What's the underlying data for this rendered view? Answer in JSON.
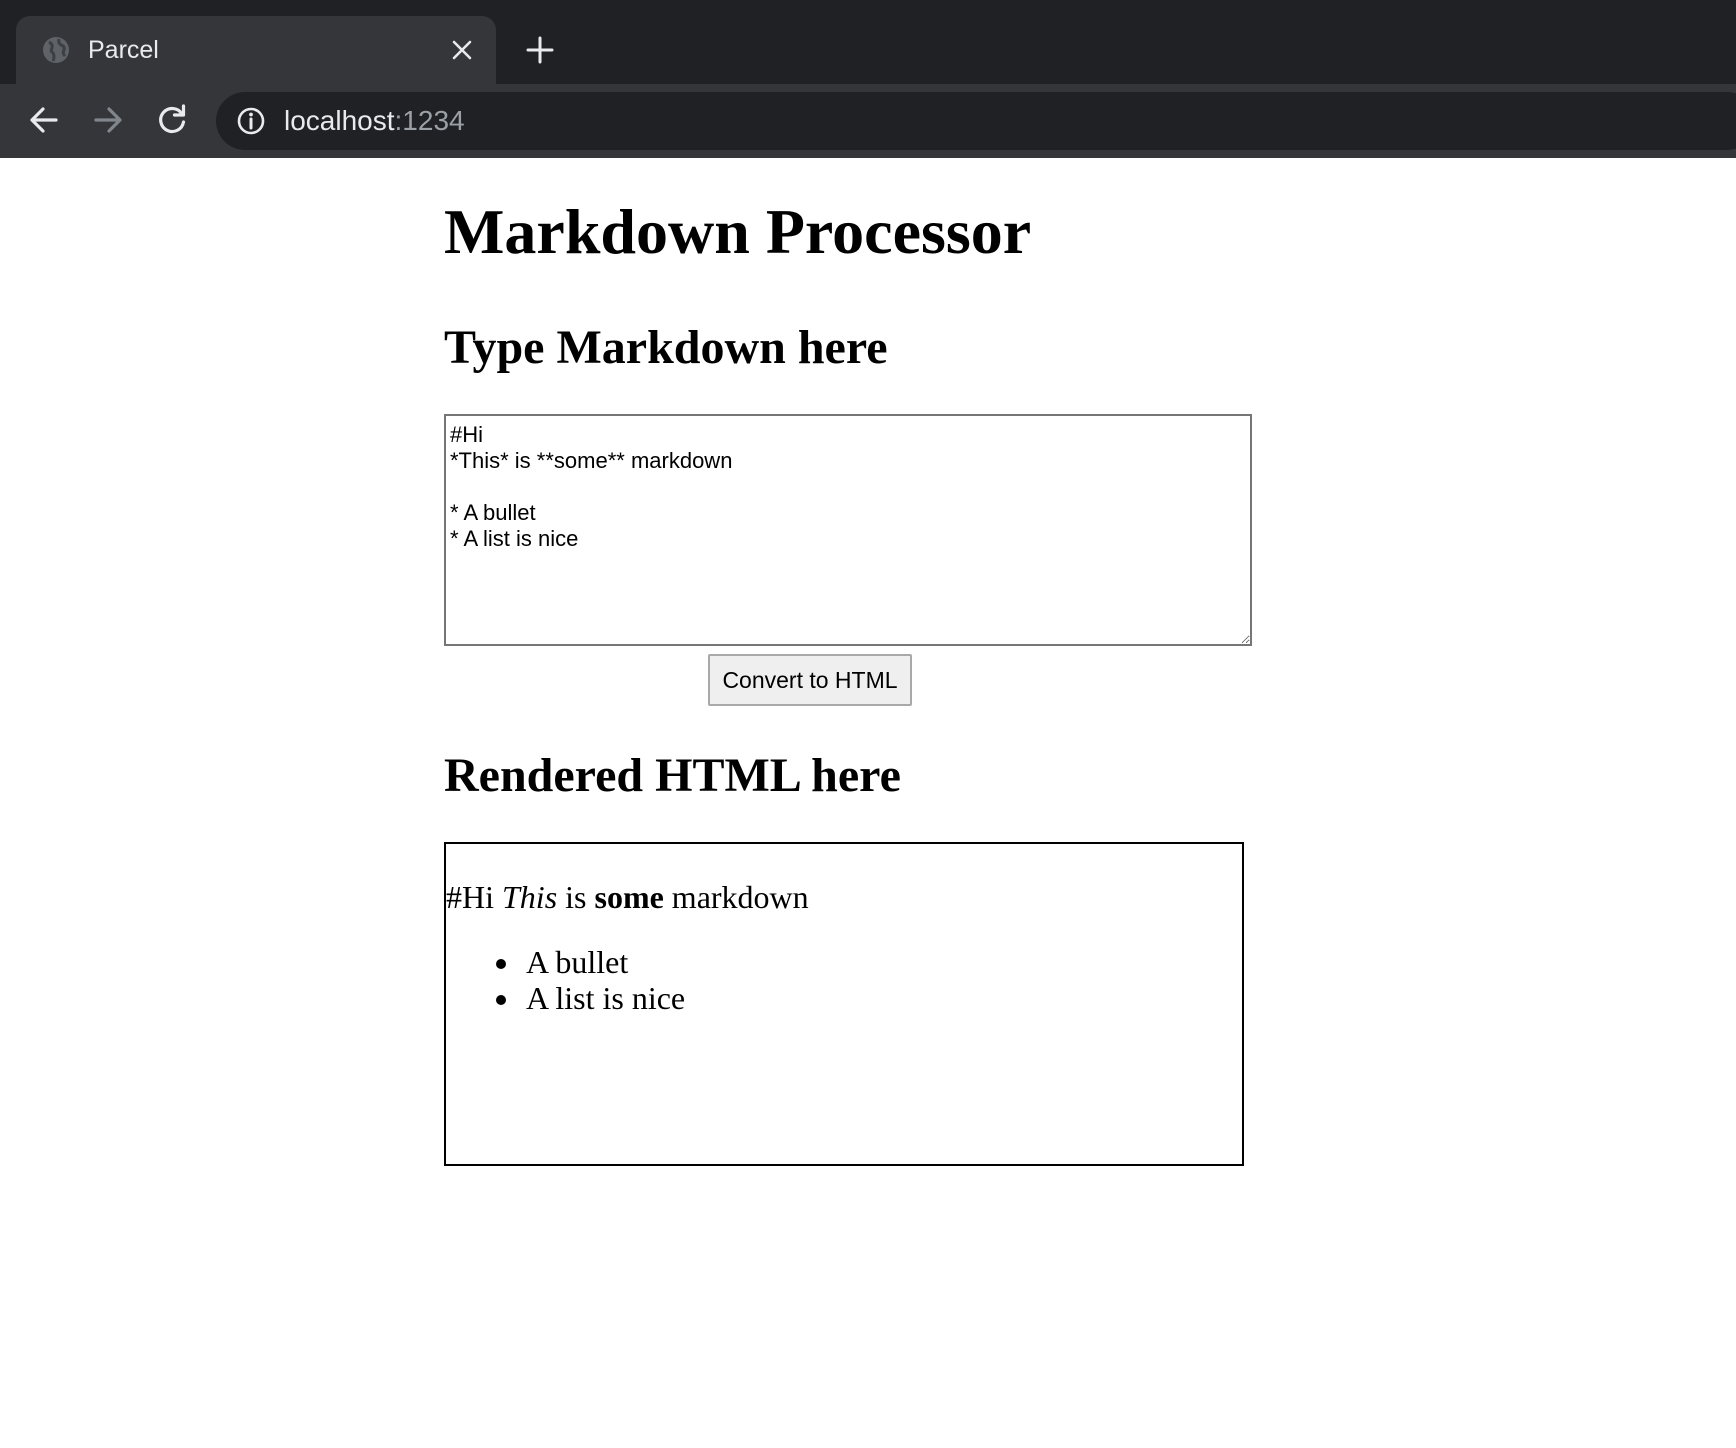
{
  "browser": {
    "tab": {
      "title": "Parcel",
      "favicon": "globe-icon",
      "close_icon": "close-icon"
    },
    "new_tab_icon": "plus-icon",
    "nav": {
      "back_icon": "arrow-left-icon",
      "forward_icon": "arrow-right-icon",
      "reload_icon": "reload-icon"
    },
    "address_bar": {
      "site_info_icon": "info-icon",
      "host": "localhost",
      "port": ":1234"
    },
    "colors": {
      "chrome_dark": "#202124",
      "chrome_toolbar": "#35363a",
      "text_light": "#e8eaed",
      "text_dim": "#9aa0a6"
    }
  },
  "page": {
    "title": "Markdown Processor",
    "input_section": {
      "heading": "Type Markdown here",
      "markdown_value": "#Hi\n*This* is **some** markdown\n\n* A bullet\n* A list is nice"
    },
    "convert_button_label": "Convert to HTML",
    "output_section": {
      "heading": "Rendered HTML here",
      "paragraph": {
        "prefix": "#Hi ",
        "italic": "This",
        "middle": " is ",
        "bold": "some",
        "suffix": " markdown"
      },
      "list_items": [
        "A bullet",
        "A list is nice"
      ]
    }
  }
}
